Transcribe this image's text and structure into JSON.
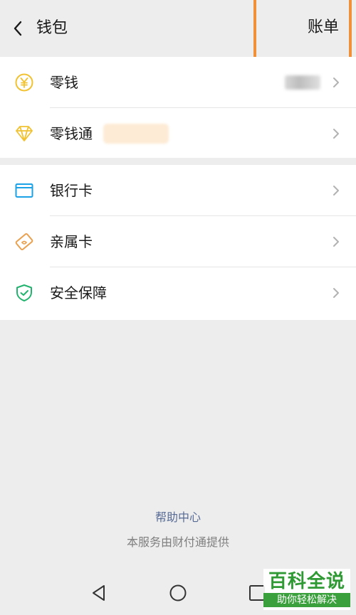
{
  "header": {
    "title": "钱包",
    "bill_label": "账单"
  },
  "group1": [
    {
      "label": "零钱",
      "icon": "yen-coin-icon"
    },
    {
      "label": "零钱通",
      "icon": "diamond-icon"
    }
  ],
  "group2": [
    {
      "label": "银行卡",
      "icon": "bank-card-icon"
    },
    {
      "label": "亲属卡",
      "icon": "family-card-icon"
    },
    {
      "label": "安全保障",
      "icon": "shield-check-icon"
    }
  ],
  "footer": {
    "help": "帮助中心",
    "note": "本服务由财付通提供"
  },
  "watermark": {
    "main": "百科全说",
    "sub": "助你轻松解决"
  },
  "colors": {
    "highlight": "#f0913a",
    "yellow": "#f1c232",
    "blue": "#1aa1e6",
    "orange": "#e9a04f",
    "green": "#22b36f",
    "link": "#576b95"
  }
}
